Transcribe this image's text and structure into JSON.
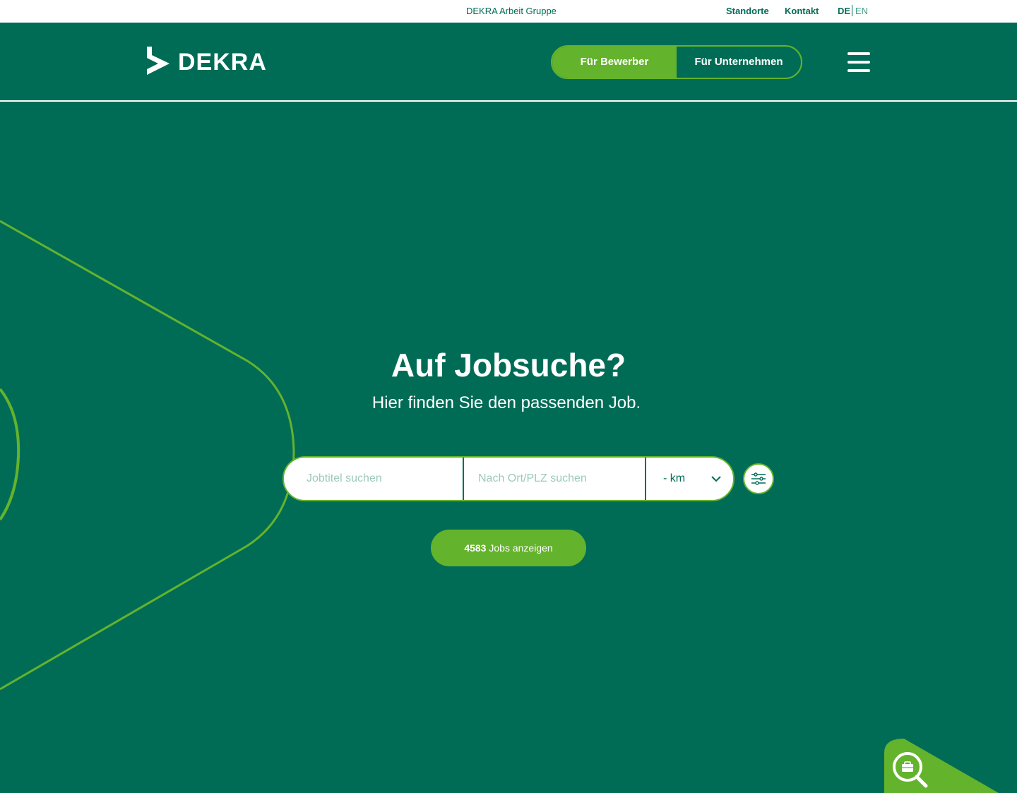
{
  "topbar": {
    "group": "DEKRA Arbeit Gruppe",
    "links": [
      "Standorte",
      "Kontakt"
    ],
    "lang_de": "DE",
    "lang_en": "EN"
  },
  "header": {
    "logo_text": "DEKRA",
    "toggle_applicants": "Für Bewerber",
    "toggle_companies": "Für Unternehmen",
    "menu_icon": "hamburger-icon"
  },
  "hero": {
    "title": "Auf Jobsuche?",
    "subtitle": "Hier finden Sie den passenden Job."
  },
  "search": {
    "job_placeholder": "Jobtitel suchen",
    "location_placeholder": "Nach Ort/PLZ suchen",
    "radius_value": "- km",
    "filter_icon": "filter-sliders-icon"
  },
  "cta": {
    "count": "4583",
    "label": "Jobs anzeigen"
  },
  "colors": {
    "brand_green": "#006c56",
    "accent_green": "#64b32c",
    "white": "#ffffff"
  },
  "corner_icon": "job-search-icon"
}
